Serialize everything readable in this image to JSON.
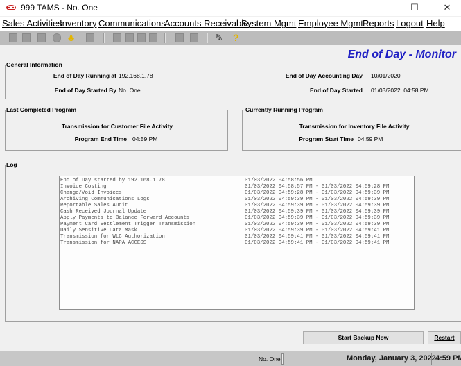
{
  "window": {
    "title": "999 TAMS - No. One",
    "minimize_glyph": "—",
    "maximize_glyph": "☐",
    "close_glyph": "✕"
  },
  "menu": [
    {
      "label": "Sales Activities"
    },
    {
      "label": "Inventory"
    },
    {
      "label": "Communications"
    },
    {
      "label": "Accounts Receivable"
    },
    {
      "label": "System Mgmt"
    },
    {
      "label": "Employee Mgmt"
    },
    {
      "label": "Reports"
    },
    {
      "label": "Logout"
    },
    {
      "label": "Help"
    }
  ],
  "toolbar": {
    "icons": [
      "new-icon",
      "save-icon",
      "print-icon",
      "find-icon",
      "user-icon",
      "delete-icon",
      "first-icon",
      "prev-icon",
      "next-icon",
      "last-icon",
      "calc-icon",
      "calendar-icon",
      "edit-icon",
      "help-icon"
    ],
    "edit_glyph": "✎",
    "help_glyph": "?",
    "user_glyph": "♣",
    "accent_yellow": "#e3b500",
    "accent_blue": "#1f1fc4"
  },
  "page": {
    "title": "End of Day - Monitor",
    "title_color": "#1f1fc4"
  },
  "general": {
    "legend": "General Information",
    "running_at_label": "End of Day Running at",
    "running_at_value": "192.168.1.78",
    "started_by_label": "End of Day Started By",
    "started_by_value": "No. One",
    "accounting_day_label": "End of Day Accounting Day",
    "accounting_day_value": "10/01/2020",
    "started_label": "End of Day Started",
    "started_value": "01/03/2022  04:58 PM"
  },
  "last_completed": {
    "legend": "Last Completed Program",
    "program": "Transmission for Customer File Activity",
    "time_label": "Program End Time",
    "time_value": "04:59 PM"
  },
  "currently_running": {
    "legend": "Currently Running Program",
    "program": "Transmission for Inventory File Activity",
    "time_label": "Program Start Time",
    "time_value": "04:59 PM"
  },
  "log": {
    "legend": "Log",
    "rows": [
      {
        "name": "End of Day started by 192.168.1.78",
        "time": "01/03/2022 04:58:56 PM"
      },
      {
        "name": "Invoice Costing",
        "time": "01/03/2022 04:58:57 PM - 01/03/2022 04:59:28 PM"
      },
      {
        "name": "Change/Void Invoices",
        "time": "01/03/2022 04:59:28 PM - 01/03/2022 04:59:39 PM"
      },
      {
        "name": "Archiving Communications Logs",
        "time": "01/03/2022 04:59:39 PM - 01/03/2022 04:59:39 PM"
      },
      {
        "name": "Reportable Sales Audit",
        "time": "01/03/2022 04:59:39 PM - 01/03/2022 04:59:39 PM"
      },
      {
        "name": "Cash Received Journal Update",
        "time": "01/03/2022 04:59:39 PM - 01/03/2022 04:59:39 PM"
      },
      {
        "name": "Apply Payments to Balance Forward Accounts",
        "time": "01/03/2022 04:59:39 PM - 01/03/2022 04:59:39 PM"
      },
      {
        "name": "Payment Card Settlement Trigger Transmission",
        "time": "01/03/2022 04:59:39 PM - 01/03/2022 04:59:39 PM"
      },
      {
        "name": "Daily Sensitive Data Mask",
        "time": "01/03/2022 04:59:39 PM - 01/03/2022 04:59:41 PM"
      },
      {
        "name": "Transmission for WLC Authorization",
        "time": "01/03/2022 04:59:41 PM - 01/03/2022 04:59:41 PM"
      },
      {
        "name": "Transmission for NAPA ACCESS",
        "time": "01/03/2022 04:59:41 PM - 01/03/2022 04:59:41 PM"
      }
    ]
  },
  "buttons": {
    "backup": "Start Backup Now",
    "restart": "Restart"
  },
  "status": {
    "user": "No. One",
    "date": "Monday, January 3, 2022",
    "time": "4:59 PM"
  }
}
